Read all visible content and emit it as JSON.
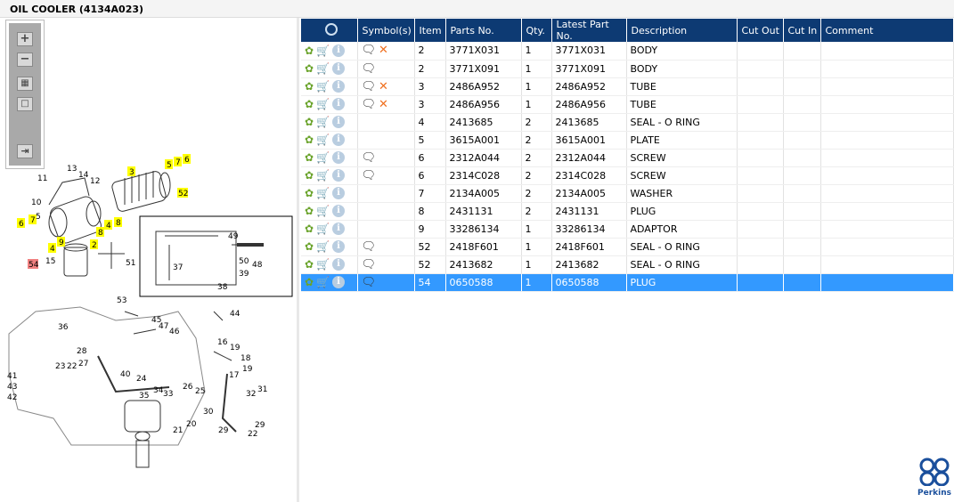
{
  "window": {
    "title": "OIL COOLER (4134A023)"
  },
  "toolbox": {
    "zoom_in": "+",
    "zoom_out": "−",
    "fit": "▦",
    "actual": "□",
    "export": "⇥"
  },
  "grid": {
    "columns": [
      "",
      "Symbol(s)",
      "Item",
      "Parts No.",
      "Qty.",
      "Latest Part No.",
      "Description",
      "Cut Out",
      "Cut In",
      "Comment"
    ],
    "rows": [
      {
        "item": "2",
        "part": "3771X031",
        "qty": "1",
        "latest": "3771X031",
        "desc": "BODY",
        "symbols": [
          "note-icon",
          "superseded-x-icon"
        ]
      },
      {
        "item": "2",
        "part": "3771X091",
        "qty": "1",
        "latest": "3771X091",
        "desc": "BODY",
        "symbols": [
          "note-icon"
        ]
      },
      {
        "item": "3",
        "part": "2486A952",
        "qty": "1",
        "latest": "2486A952",
        "desc": "TUBE",
        "symbols": [
          "note-icon",
          "superseded-x-icon"
        ]
      },
      {
        "item": "3",
        "part": "2486A956",
        "qty": "1",
        "latest": "2486A956",
        "desc": "TUBE",
        "symbols": [
          "note-icon",
          "superseded-x-icon"
        ]
      },
      {
        "item": "4",
        "part": "2413685",
        "qty": "2",
        "latest": "2413685",
        "desc": "SEAL - O RING",
        "symbols": []
      },
      {
        "item": "5",
        "part": "3615A001",
        "qty": "2",
        "latest": "3615A001",
        "desc": "PLATE",
        "symbols": []
      },
      {
        "item": "6",
        "part": "2312A044",
        "qty": "2",
        "latest": "2312A044",
        "desc": "SCREW",
        "symbols": [
          "note-icon"
        ]
      },
      {
        "item": "6",
        "part": "2314C028",
        "qty": "2",
        "latest": "2314C028",
        "desc": "SCREW",
        "symbols": [
          "note-icon"
        ]
      },
      {
        "item": "7",
        "part": "2134A005",
        "qty": "2",
        "latest": "2134A005",
        "desc": "WASHER",
        "symbols": []
      },
      {
        "item": "8",
        "part": "2431131",
        "qty": "2",
        "latest": "2431131",
        "desc": "PLUG",
        "symbols": []
      },
      {
        "item": "9",
        "part": "33286134",
        "qty": "1",
        "latest": "33286134",
        "desc": "ADAPTOR",
        "symbols": []
      },
      {
        "item": "52",
        "part": "2418F601",
        "qty": "1",
        "latest": "2418F601",
        "desc": "SEAL - O RING",
        "symbols": [
          "note-icon"
        ]
      },
      {
        "item": "52",
        "part": "2413682",
        "qty": "1",
        "latest": "2413682",
        "desc": "SEAL - O RING",
        "symbols": [
          "note-icon"
        ]
      },
      {
        "item": "54",
        "part": "0650588",
        "qty": "1",
        "latest": "0650588",
        "desc": "PLUG",
        "symbols": [
          "note-icon"
        ],
        "selected": true
      }
    ]
  },
  "diagram": {
    "highlighted_callouts": [
      "3",
      "5",
      "7",
      "6",
      "52",
      "6",
      "7",
      "5",
      "4",
      "8",
      "8",
      "4",
      "9",
      "2"
    ],
    "selected_callout": "54",
    "callouts": [
      "13",
      "14",
      "12",
      "11",
      "10",
      "15",
      "51",
      "49",
      "50",
      "48",
      "37",
      "39",
      "38",
      "53",
      "45",
      "47",
      "46",
      "44",
      "36",
      "28",
      "27",
      "23",
      "22",
      "41",
      "43",
      "42",
      "40",
      "24",
      "35",
      "34",
      "33",
      "26",
      "25",
      "21",
      "20",
      "30",
      "29",
      "17",
      "16",
      "19",
      "18",
      "31",
      "32"
    ]
  },
  "logo": {
    "text": "Perkins"
  },
  "colors": {
    "header": "#0d3a73",
    "selected": "#3399ff",
    "highlight": "#ffff00",
    "selected_callout": "#f08080"
  }
}
